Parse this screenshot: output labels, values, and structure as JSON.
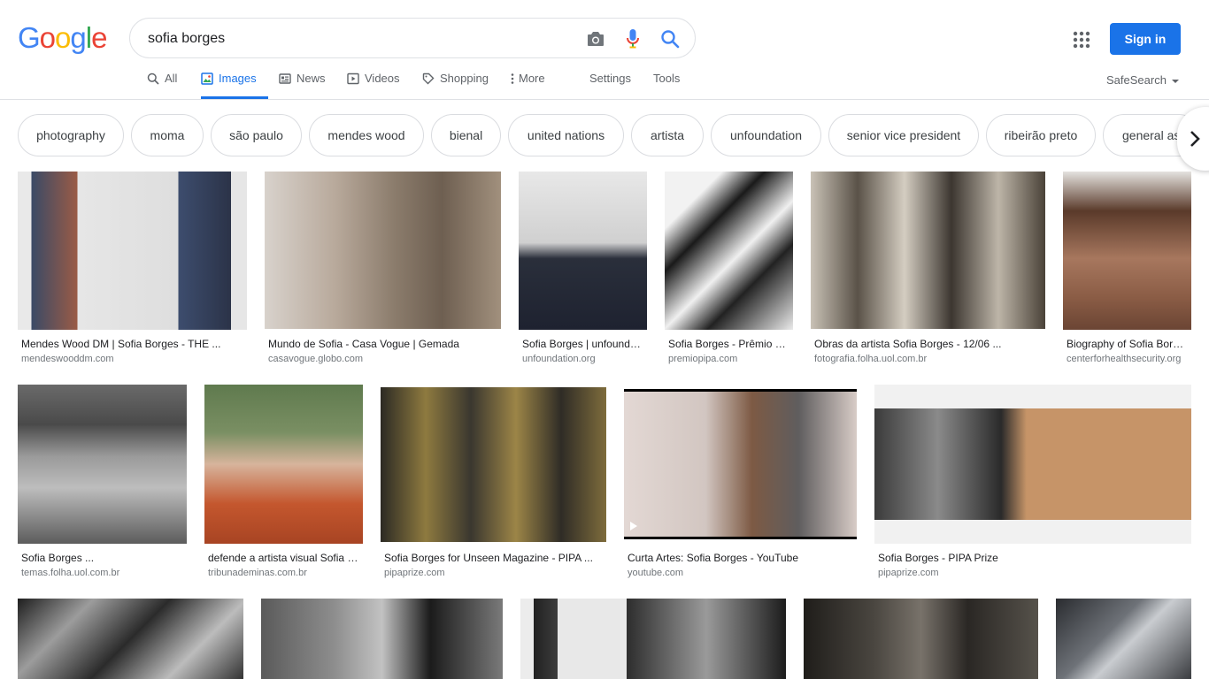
{
  "header": {
    "logo_letters": [
      {
        "ch": "G",
        "color": "#4285F4"
      },
      {
        "ch": "o",
        "color": "#EA4335"
      },
      {
        "ch": "o",
        "color": "#FBBC05"
      },
      {
        "ch": "g",
        "color": "#4285F4"
      },
      {
        "ch": "l",
        "color": "#34A853"
      },
      {
        "ch": "e",
        "color": "#EA4335"
      }
    ],
    "search_value": "sofia borges",
    "signin_label": "Sign in",
    "icons": [
      "camera-icon",
      "microphone-icon",
      "search-icon",
      "apps-icon"
    ]
  },
  "tabs": [
    {
      "label": "All",
      "icon": "search-icon"
    },
    {
      "label": "Images",
      "icon": "image-icon",
      "active": true
    },
    {
      "label": "News",
      "icon": "news-icon"
    },
    {
      "label": "Videos",
      "icon": "video-icon"
    },
    {
      "label": "Shopping",
      "icon": "tag-icon"
    },
    {
      "label": "More",
      "icon": "more-vert-icon"
    },
    {
      "label": "Settings"
    },
    {
      "label": "Tools"
    }
  ],
  "safesearch_label": "SafeSearch",
  "chips": [
    "photography",
    "moma",
    "são paulo",
    "mendes wood",
    "bienal",
    "united nations",
    "artista",
    "unfoundation",
    "senior vice president",
    "ribeirão preto",
    "general as"
  ],
  "results": [
    {
      "caption": "Mendes Wood DM | Sofia Borges - THE ...",
      "source": "mendeswooddm.com"
    },
    {
      "caption": "Mundo de Sofia - Casa Vogue | Gemada",
      "source": "casavogue.globo.com"
    },
    {
      "caption": "Sofia Borges | unfoundation.org",
      "source": "unfoundation.org"
    },
    {
      "caption": "Sofia Borges - Prêmio PIPA",
      "source": "premiopipa.com"
    },
    {
      "caption": "Obras da artista Sofia Borges - 12/06 ...",
      "source": "fotografia.folha.uol.com.br"
    },
    {
      "caption": "Biography of Sofia Borges",
      "source": "centerforhealthsecurity.org"
    },
    {
      "caption": "Sofia Borges ...",
      "source": "temas.folha.uol.com.br"
    },
    {
      "caption": "defende a artista visual Sofia Borges",
      "source": "tribunademinas.com.br"
    },
    {
      "caption": "Sofia Borges for Unseen Magazine - PIPA ...",
      "source": "pipaprize.com"
    },
    {
      "caption": "Curta Artes: Sofia Borges - YouTube",
      "source": "youtube.com"
    },
    {
      "caption": "Sofia Borges - PIPA Prize",
      "source": "pipaprize.com"
    },
    {
      "caption": "",
      "source": ""
    },
    {
      "caption": "",
      "source": ""
    },
    {
      "caption": "",
      "source": ""
    },
    {
      "caption": "",
      "source": ""
    },
    {
      "caption": "",
      "source": ""
    }
  ]
}
